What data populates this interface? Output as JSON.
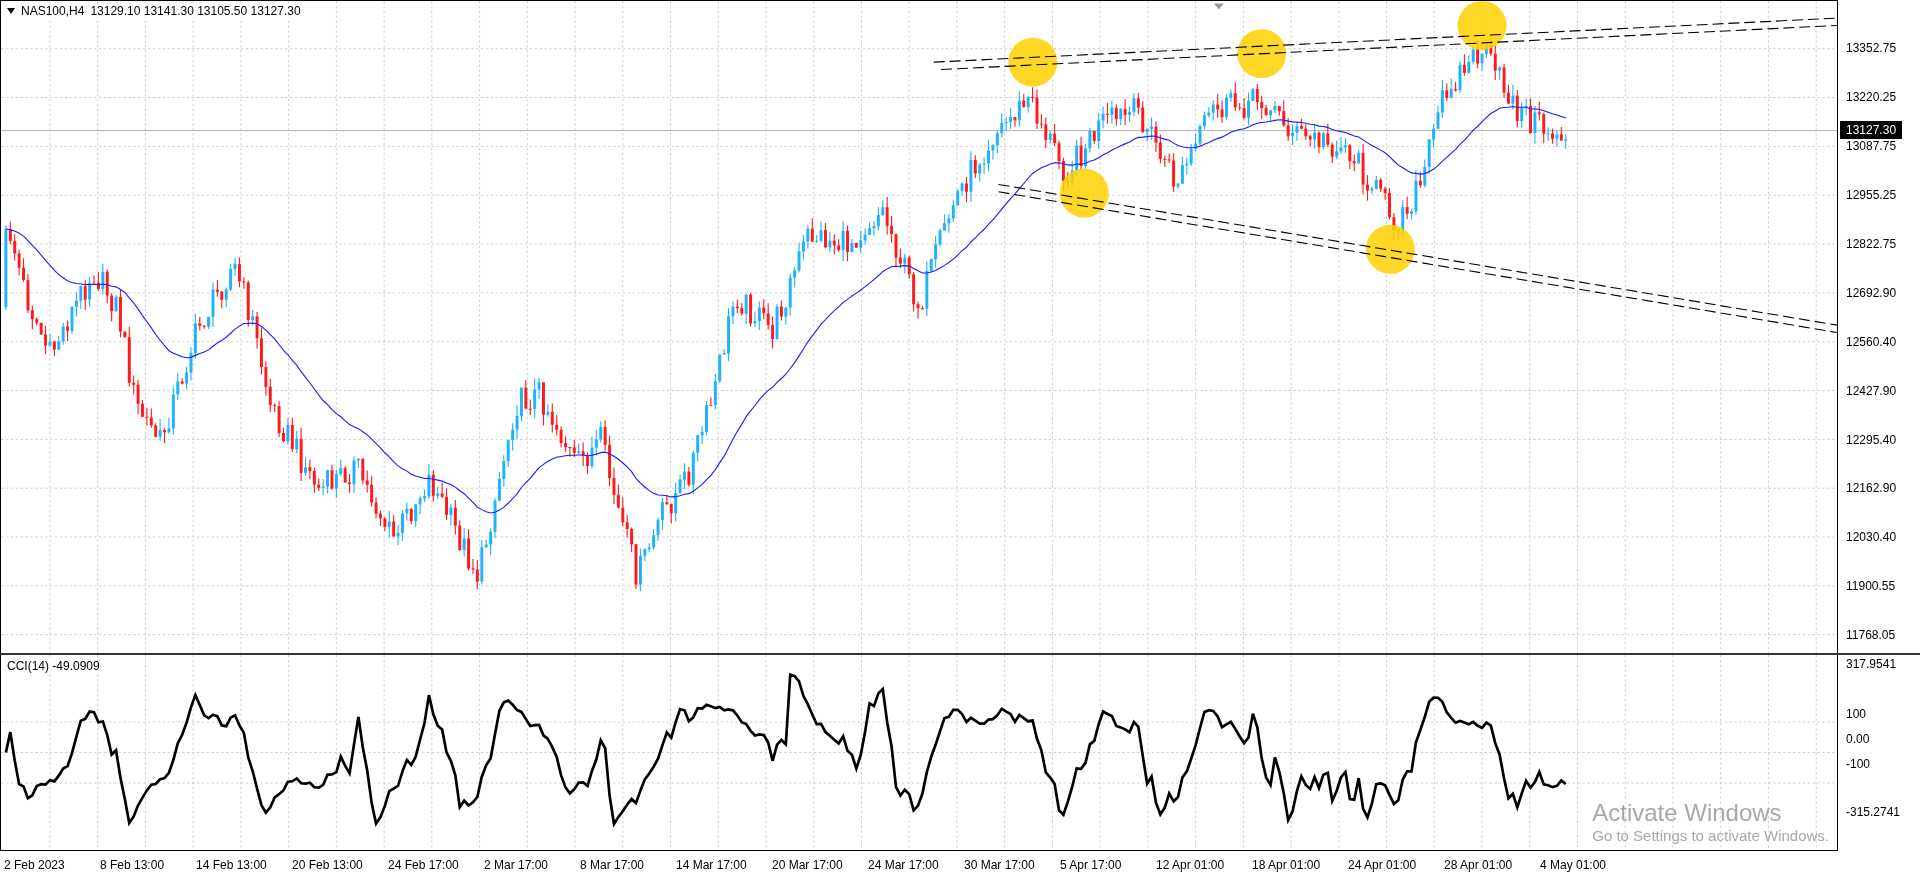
{
  "header": {
    "symbol": "NAS100,H4",
    "ohlc": "13129.10 13141.30 13105.50 13127.30"
  },
  "price_axis": {
    "labels": [
      "13352.75",
      "13220.25",
      "13087.75",
      "12955.25",
      "12822.75",
      "12692.90",
      "12560.40",
      "12427.90",
      "12295.40",
      "12162.90",
      "12030.40",
      "11900.55",
      "11768.05"
    ],
    "current_price": "13127.30"
  },
  "indicator": {
    "label": "CCI(14) -49.0909",
    "axis_labels": [
      "317.9541",
      "100",
      "0.00",
      "-100",
      "-315.2741"
    ]
  },
  "time_axis": {
    "labels": [
      "2 Feb 2023",
      "8 Feb 13:00",
      "14 Feb 13:00",
      "20 Feb 13:00",
      "24 Feb 17:00",
      "2 Mar 17:00",
      "8 Mar 17:00",
      "14 Mar 17:00",
      "20 Mar 17:00",
      "24 Mar 17:00",
      "30 Mar 17:00",
      "5 Apr 17:00",
      "12 Apr 01:00",
      "18 Apr 01:00",
      "24 Apr 01:00",
      "28 Apr 01:00",
      "4 May 01:00"
    ]
  },
  "os_notice": {
    "title": "Activate Windows",
    "subtitle": "Go to Settings to activate Windows."
  }
}
